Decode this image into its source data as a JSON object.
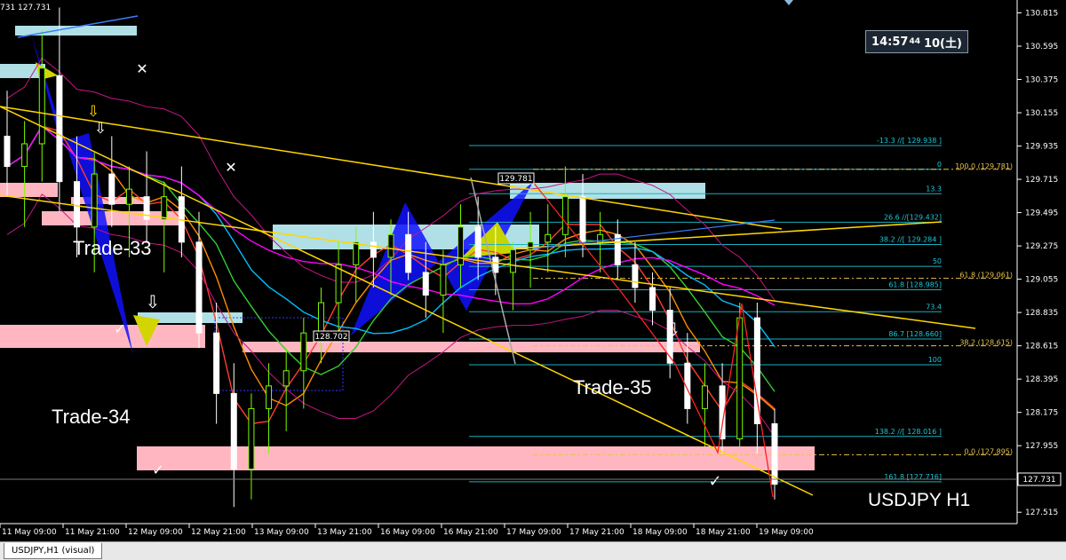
{
  "chart_data": {
    "type": "candlestick",
    "symbol_label": "USDJPY H1",
    "header_text": "731 127.731",
    "current_price": "127.731",
    "y_ticks": [
      "130.815",
      "130.595",
      "130.375",
      "130.155",
      "129.935",
      "129.715",
      "129.495",
      "129.275",
      "129.055",
      "128.835",
      "128.615",
      "128.395",
      "128.175",
      "127.955",
      "127.731",
      "127.515"
    ],
    "ylim": [
      127.44,
      130.9
    ],
    "x_ticks": [
      "11 May 09:00",
      "11 May 21:00",
      "12 May 09:00",
      "12 May 21:00",
      "13 May 09:00",
      "13 May 21:00",
      "16 May 09:00",
      "16 May 21:00",
      "17 May 09:00",
      "17 May 21:00",
      "18 May 09:00",
      "18 May 21:00",
      "19 May 09:00"
    ],
    "trade_labels": [
      "Trade-33",
      "Trade-34",
      "Trade-35"
    ],
    "price_box_labels": [
      "129.781",
      "128.702"
    ],
    "fib_left_labels": [
      {
        "text": "-13.3  //[ 129.938 ]",
        "price": 129.938
      },
      {
        "text": "0",
        "price": 129.781
      },
      {
        "text": "13.3",
        "price": 129.62
      },
      {
        "text": "26.6 //[129.432]",
        "price": 129.432
      },
      {
        "text": "38.2  //[ 129.284 ]",
        "price": 129.284
      },
      {
        "text": "50",
        "price": 129.14
      },
      {
        "text": "61.8 [128.985]",
        "price": 128.985
      },
      {
        "text": "73.4",
        "price": 128.84
      },
      {
        "text": "86.7 [128.660]",
        "price": 128.66
      },
      {
        "text": "100",
        "price": 128.49
      },
      {
        "text": "138.2  //[ 128.016 ]",
        "price": 128.016
      },
      {
        "text": "161.8 [127.716]",
        "price": 127.716
      }
    ],
    "fib_right_labels": [
      {
        "text": "100.0 (129.781)",
        "price": 129.781
      },
      {
        "text": "61.8 (129.061)",
        "price": 129.061
      },
      {
        "text": "38.2 (128.615)",
        "price": 128.615
      },
      {
        "text": "0.0 (127.895)",
        "price": 127.895
      }
    ],
    "candles": [
      [
        130.0,
        130.3,
        129.6,
        129.8
      ],
      [
        129.8,
        130.1,
        129.4,
        129.95
      ],
      [
        129.95,
        130.7,
        129.7,
        130.45
      ],
      [
        130.4,
        130.85,
        129.5,
        129.7
      ],
      [
        129.7,
        130.0,
        129.2,
        129.4
      ],
      [
        129.4,
        129.9,
        129.1,
        129.75
      ],
      [
        129.75,
        130.0,
        129.4,
        129.55
      ],
      [
        129.55,
        129.8,
        129.2,
        129.65
      ],
      [
        129.6,
        129.9,
        129.3,
        129.45
      ],
      [
        129.45,
        129.7,
        129.1,
        129.6
      ],
      [
        129.6,
        129.8,
        129.2,
        129.3
      ],
      [
        129.3,
        129.5,
        128.6,
        128.7
      ],
      [
        128.7,
        128.9,
        128.1,
        128.3
      ],
      [
        128.3,
        128.5,
        127.55,
        127.8
      ],
      [
        127.8,
        128.3,
        127.6,
        128.2
      ],
      [
        128.2,
        128.5,
        127.9,
        128.35
      ],
      [
        128.35,
        128.6,
        128.05,
        128.45
      ],
      [
        128.45,
        128.8,
        128.2,
        128.7
      ],
      [
        128.7,
        129.0,
        128.5,
        128.9
      ],
      [
        128.9,
        129.3,
        128.7,
        129.15
      ],
      [
        129.15,
        129.4,
        128.9,
        129.3
      ],
      [
        129.3,
        129.5,
        129.0,
        129.2
      ],
      [
        129.2,
        129.45,
        128.95,
        129.35
      ],
      [
        129.35,
        129.5,
        129.05,
        129.1
      ],
      [
        129.1,
        129.3,
        128.8,
        128.95
      ],
      [
        128.95,
        129.25,
        128.7,
        129.15
      ],
      [
        129.15,
        129.55,
        129.0,
        129.4
      ],
      [
        129.4,
        129.6,
        129.05,
        129.2
      ],
      [
        129.2,
        129.4,
        128.95,
        129.1
      ],
      [
        129.1,
        129.3,
        128.85,
        129.25
      ],
      [
        129.25,
        129.5,
        129.0,
        129.3
      ],
      [
        129.3,
        129.55,
        129.1,
        129.35
      ],
      [
        129.35,
        129.8,
        129.2,
        129.6
      ],
      [
        129.6,
        129.75,
        129.2,
        129.3
      ],
      [
        129.3,
        129.5,
        129.1,
        129.35
      ],
      [
        129.35,
        129.45,
        129.05,
        129.15
      ],
      [
        129.15,
        129.3,
        128.9,
        129.0
      ],
      [
        129.0,
        129.1,
        128.75,
        128.85
      ],
      [
        128.85,
        129.0,
        128.4,
        128.5
      ],
      [
        128.5,
        128.7,
        128.1,
        128.2
      ],
      [
        128.2,
        128.5,
        127.95,
        128.35
      ],
      [
        128.35,
        128.5,
        127.9,
        128.0
      ],
      [
        128.0,
        128.9,
        127.95,
        128.8
      ],
      [
        128.8,
        128.9,
        127.9,
        128.1
      ],
      [
        128.1,
        128.2,
        127.6,
        127.7
      ]
    ]
  },
  "clock": {
    "time": "14:57",
    "seconds": "44",
    "day": "10(土)"
  },
  "tab": {
    "label": "USDJPY,H1 (visual)"
  }
}
